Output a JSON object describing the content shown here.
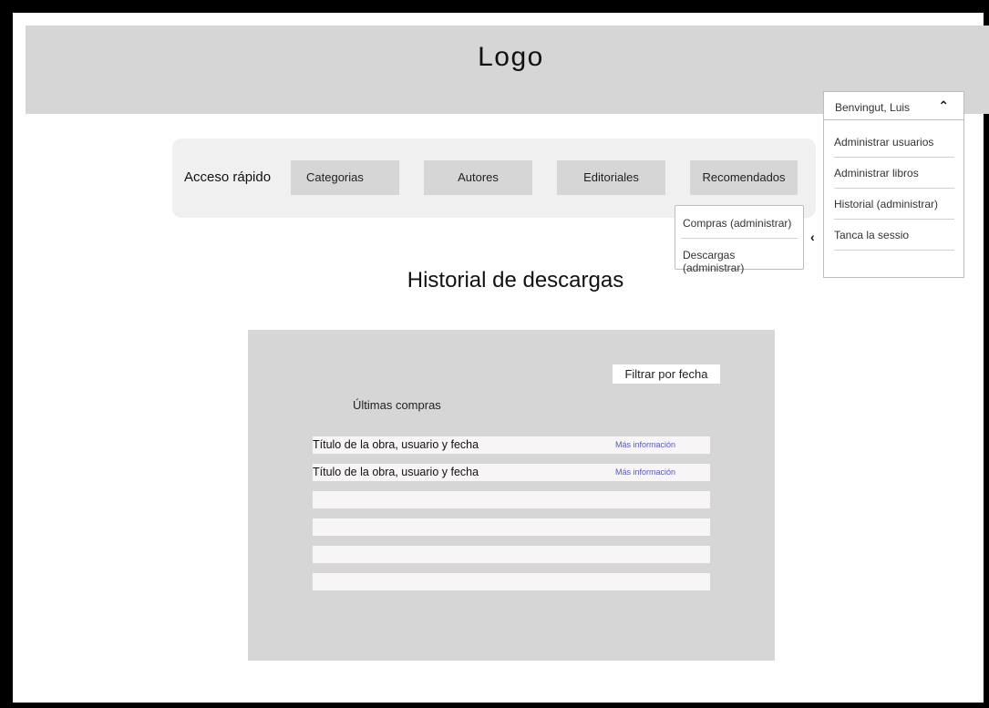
{
  "header": {
    "logo": "Logo"
  },
  "user_menu": {
    "user_name": "Benvingut, Luis",
    "items": [
      {
        "label": "Administrar usuarios"
      },
      {
        "label": "Administrar libros"
      },
      {
        "label": "Historial (administrar)"
      },
      {
        "label": "Tanca la sessio"
      }
    ]
  },
  "quick_access": {
    "label": "Acceso rápido",
    "buttons": [
      {
        "label": "Categorias"
      },
      {
        "label": "Autores"
      },
      {
        "label": "Editoriales"
      },
      {
        "label": "Recomendados"
      }
    ]
  },
  "history_submenu": {
    "items": [
      {
        "label": "Compras (administrar)"
      },
      {
        "label": "Descargas (administrar)"
      }
    ]
  },
  "page": {
    "title": "Historial de descargas"
  },
  "panel": {
    "filter_label": "Filtrar por fecha",
    "section_label": "Últimas compras",
    "rows": [
      {
        "title": "Título de la obra, usuario y fecha",
        "link": "Más información"
      },
      {
        "title": "Título de la obra, usuario y fecha",
        "link": "Más información"
      },
      {
        "title": "",
        "link": ""
      },
      {
        "title": "",
        "link": ""
      },
      {
        "title": "",
        "link": ""
      },
      {
        "title": "",
        "link": ""
      }
    ]
  }
}
